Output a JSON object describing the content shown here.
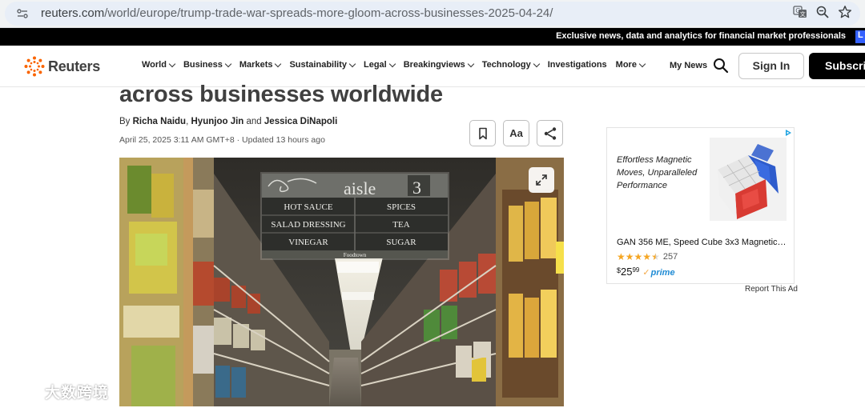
{
  "browser": {
    "url_domain": "reuters.com",
    "url_path": "/world/europe/trump-trade-war-spreads-more-gloom-across-businesses-2025-04-24/",
    "icons": [
      "site-info-icon",
      "translate-icon",
      "zoom-icon",
      "bookmark-star-icon"
    ]
  },
  "promo": {
    "text": "Exclusive news, data and analytics for financial market professionals",
    "badge": "L"
  },
  "nav": {
    "logo_text": "Reuters",
    "items": [
      "World",
      "Business",
      "Markets",
      "Sustainability",
      "Legal",
      "Breakingviews",
      "Technology",
      "Investigations",
      "More"
    ],
    "my_news": "My News",
    "sign_in": "Sign In",
    "subscribe": "Subscribe"
  },
  "article": {
    "headline": "across businesses worldwide",
    "byline_prefix": "By",
    "authors": [
      "Richa Naidu",
      "Hyunjoo Jin",
      "Jessica DiNapoli"
    ],
    "byline_sep": ",",
    "byline_and": "and",
    "date": "April 25, 2025 3:11 AM GMT+8",
    "updated": "Updated 13 hours ago",
    "tools": {
      "text_size_label": "Aa"
    },
    "photo": {
      "aisle_word": "aisle",
      "aisle_number": "3",
      "sign_rows": [
        [
          "HOT SAUCE",
          "SPICES"
        ],
        [
          "SALAD DRESSING",
          "TEA"
        ],
        [
          "VINEGAR",
          "SUGAR"
        ]
      ],
      "store_name": "Foodtown"
    }
  },
  "ad": {
    "tagline": "Effortless Magnetic Moves, Unparalleled Performance",
    "product_title": "GAN 356 ME, Speed Cube 3x3 Magnetic…",
    "rating_stars": 4.5,
    "rating_count": "257",
    "price_symbol": "$",
    "price_whole": "25",
    "price_cents": "99",
    "prime_label": "prime",
    "report_link": "Report This Ad"
  },
  "watermark": {
    "text": "大数跨境"
  },
  "colors": {
    "accent_orange": "#fa6400",
    "subscribe_bg": "#000000",
    "prime_blue": "#1f8bd4"
  }
}
